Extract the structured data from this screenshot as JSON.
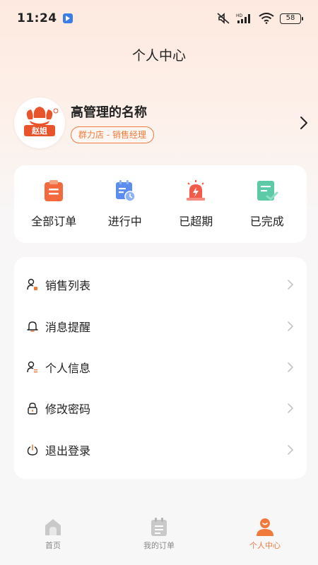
{
  "status_bar": {
    "time": "11:24",
    "network_label": "HD",
    "battery": "58"
  },
  "page": {
    "title": "个人中心"
  },
  "profile": {
    "name": "高管理的名称",
    "badge": "群力店 - 销售经理",
    "avatar_text": "赵姐"
  },
  "orders": [
    {
      "label": "全部订单",
      "icon": "clipboard-icon"
    },
    {
      "label": "进行中",
      "icon": "calendar-clock-icon"
    },
    {
      "label": "已超期",
      "icon": "alarm-icon"
    },
    {
      "label": "已完成",
      "icon": "check-document-icon"
    }
  ],
  "menu": [
    {
      "label": "销售列表",
      "icon": "user-lock-icon"
    },
    {
      "label": "消息提醒",
      "icon": "bell-icon"
    },
    {
      "label": "个人信息",
      "icon": "user-list-icon"
    },
    {
      "label": "修改密码",
      "icon": "lock-icon"
    },
    {
      "label": "退出登录",
      "icon": "power-icon"
    }
  ],
  "tabs": [
    {
      "label": "首页",
      "icon": "home-icon",
      "active": false
    },
    {
      "label": "我的订单",
      "icon": "order-list-icon",
      "active": false
    },
    {
      "label": "个人中心",
      "icon": "person-icon",
      "active": true
    }
  ],
  "colors": {
    "accent": "#f07a3c",
    "order_orange": "#f26a3d",
    "order_blue": "#5b8def",
    "order_red": "#f25a4a",
    "order_green": "#5cc9a7"
  }
}
